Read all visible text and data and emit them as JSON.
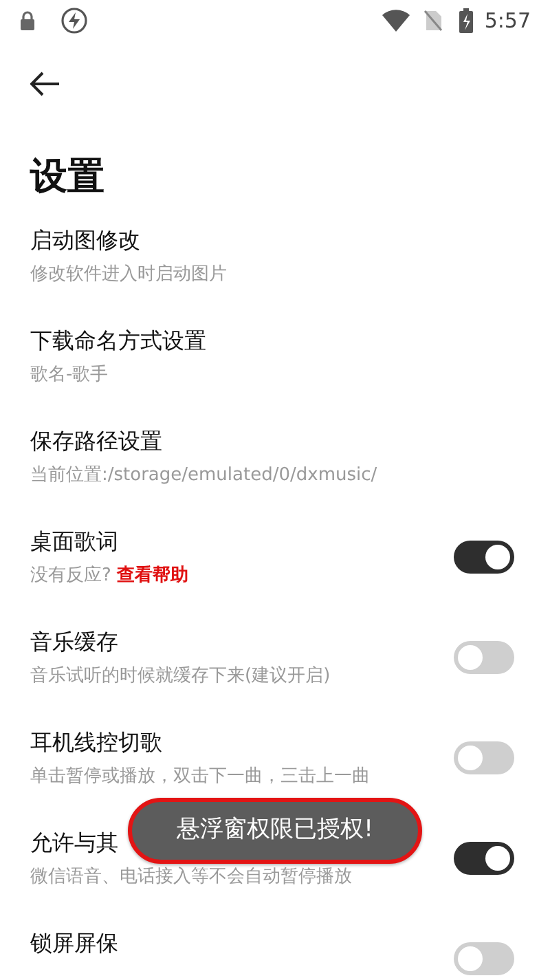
{
  "status_bar": {
    "time": "5:57"
  },
  "title": "设置",
  "items": [
    {
      "kind": "link",
      "title": "启动图修改",
      "subtitle": "修改软件进入时启动图片"
    },
    {
      "kind": "link",
      "title": "下载命名方式设置",
      "subtitle": "歌名-歌手"
    },
    {
      "kind": "link",
      "title": "保存路径设置",
      "subtitle": "当前位置:/storage/emulated/0/dxmusic/"
    },
    {
      "kind": "toggle",
      "title": "桌面歌词",
      "subtitle": "没有反应?",
      "help_link": "查看帮助",
      "on": true
    },
    {
      "kind": "toggle",
      "title": "音乐缓存",
      "subtitle": "音乐试听的时候就缓存下来(建议开启)",
      "on": false
    },
    {
      "kind": "toggle",
      "title": "耳机线控切歌",
      "subtitle": "单击暂停或播放，双击下一曲，三击上一曲",
      "on": false
    },
    {
      "kind": "toggle",
      "title": "允许与其",
      "subtitle": "微信语音、电话接入等不会自动暂停播放",
      "on": true
    },
    {
      "kind": "toggle",
      "title": "锁屏屏保",
      "on": false
    }
  ],
  "toast": {
    "text": "悬浮窗权限已授权!"
  }
}
